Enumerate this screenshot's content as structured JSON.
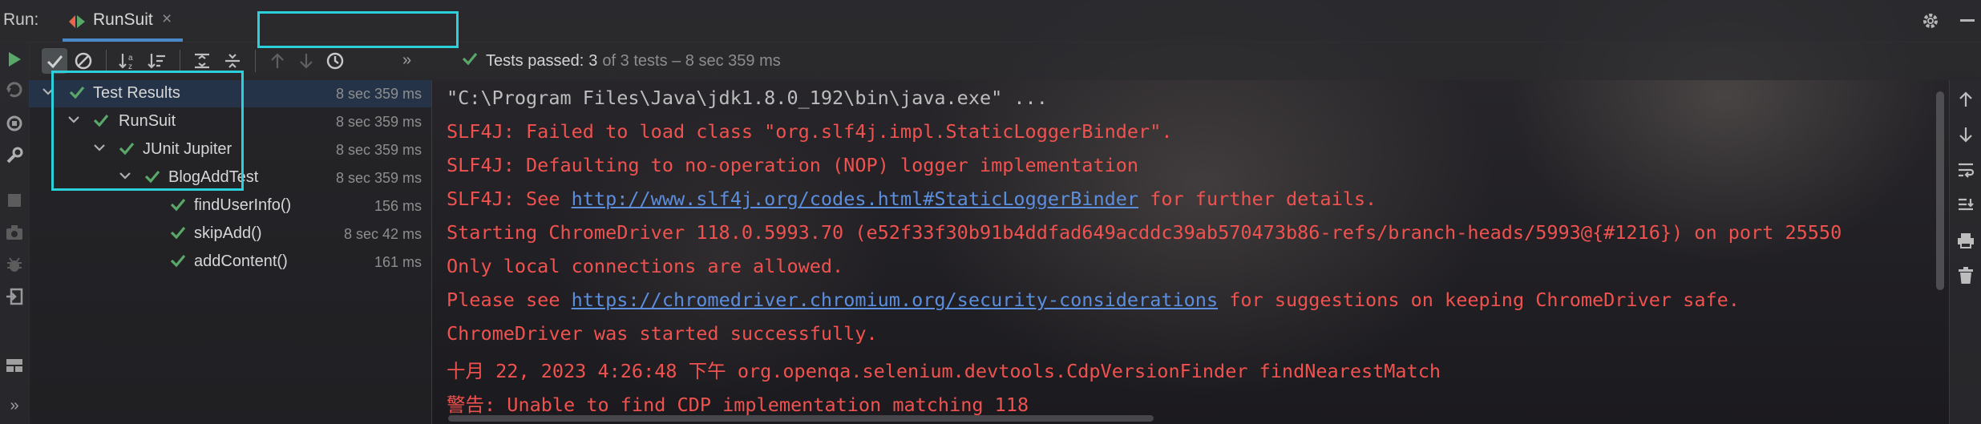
{
  "header": {
    "run_label": "Run:",
    "tab_label": "RunSuit",
    "tab_close": "×"
  },
  "status": {
    "passed_label": "Tests passed:",
    "count": "3",
    "detail": "of 3 tests – 8 sec 359 ms"
  },
  "tree": [
    {
      "name": "Test Results",
      "time": "8 sec 359 ms"
    },
    {
      "name": "RunSuit",
      "time": "8 sec 359 ms"
    },
    {
      "name": "JUnit Jupiter",
      "time": "8 sec 359 ms"
    },
    {
      "name": "BlogAddTest",
      "time": "8 sec 359 ms"
    },
    {
      "name": "findUserInfo()",
      "time": "156 ms"
    },
    {
      "name": "skipAdd()",
      "time": "8 sec 42 ms"
    },
    {
      "name": "addContent()",
      "time": "161 ms"
    }
  ],
  "console": {
    "line0": "\"C:\\Program Files\\Java\\jdk1.8.0_192\\bin\\java.exe\" ...",
    "line1": "SLF4J: Failed to load class \"org.slf4j.impl.StaticLoggerBinder\".",
    "line2": "SLF4J: Defaulting to no-operation (NOP) logger implementation",
    "line3_pre": "SLF4J: See ",
    "line3_link": "http://www.slf4j.org/codes.html#StaticLoggerBinder",
    "line3_post": " for further details.",
    "line4": "Starting ChromeDriver 118.0.5993.70 (e52f33f30b91b4ddfad649acddc39ab570473b86-refs/branch-heads/5993@{#1216}) on port 25550",
    "line5": "Only local connections are allowed.",
    "line6_pre": "Please see ",
    "line6_link": "https://chromedriver.chromium.org/security-considerations",
    "line6_post": " for suggestions on keeping ChromeDriver safe.",
    "line7": "ChromeDriver was started successfully.",
    "line8": "十月 22, 2023 4:26:48 下午 org.openqa.selenium.devtools.CdpVersionFinder findNearestMatch",
    "line9": "警告: Unable to find CDP implementation matching 118"
  },
  "left_toolbar_more": "»",
  "toolbar_more": "»",
  "colors": {
    "accent_green": "#59a869",
    "error_red": "#f0524f",
    "link_blue": "#5c8ede",
    "highlight_cyan": "#2bd0da",
    "tab_underline": "#4a88c7"
  },
  "icons": [
    "rerun-icon",
    "rerun-failed-icon",
    "toggle-auto-test-icon",
    "wrench-icon",
    "stop-icon",
    "camera-icon",
    "debug-bug-icon",
    "exit-icon",
    "layout-icon",
    "show-passed-icon",
    "show-ignored-icon",
    "sort-alpha-icon",
    "sort-duration-icon",
    "expand-all-icon",
    "collapse-all-icon",
    "previous-test-icon",
    "next-test-icon",
    "history-icon",
    "up-arrow-icon",
    "down-arrow-icon",
    "soft-wrap-icon",
    "scroll-to-end-icon",
    "print-icon",
    "trash-icon",
    "settings-icon"
  ]
}
